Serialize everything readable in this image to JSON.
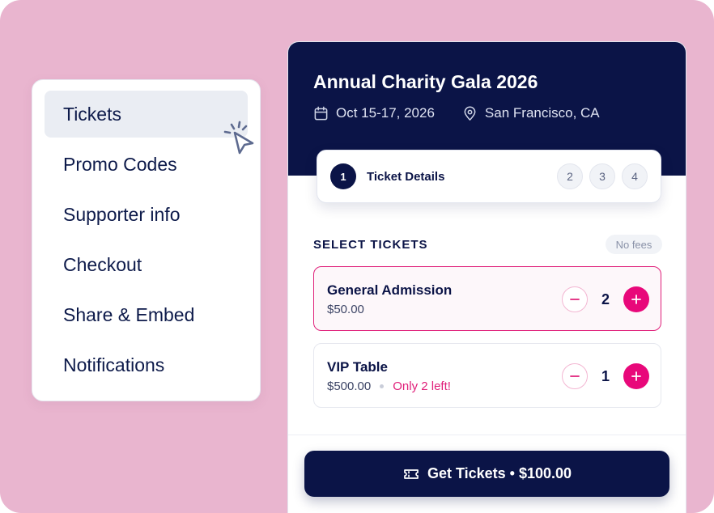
{
  "menu": {
    "items": [
      {
        "label": "Tickets",
        "active": true
      },
      {
        "label": "Promo Codes",
        "active": false
      },
      {
        "label": "Supporter info",
        "active": false
      },
      {
        "label": "Checkout",
        "active": false
      },
      {
        "label": "Share & Embed",
        "active": false
      },
      {
        "label": "Notifications",
        "active": false
      }
    ]
  },
  "event": {
    "title": "Annual Charity Gala 2026",
    "dates": "Oct 15-17, 2026",
    "location": "San Francisco, CA",
    "calendar_icon": "calendar-icon",
    "location_icon": "map-pin-icon"
  },
  "stepper": {
    "active_step": "1",
    "active_label": "Ticket Details",
    "other_steps": [
      "2",
      "3",
      "4"
    ]
  },
  "tickets_section": {
    "title": "SELECT TICKETS",
    "badge": "No fees",
    "items": [
      {
        "name": "General Admission",
        "price": "$50.00",
        "quantity": "2",
        "note": "",
        "selected": true
      },
      {
        "name": "VIP Table",
        "price": "$500.00",
        "quantity": "1",
        "note": "Only 2 left!",
        "selected": false
      }
    ]
  },
  "cta": {
    "label": "Get Tickets • $100.00",
    "icon": "ticket-icon"
  },
  "colors": {
    "background": "#e9b5cf",
    "navy": "#0b1447",
    "accent": "#e8087a"
  }
}
